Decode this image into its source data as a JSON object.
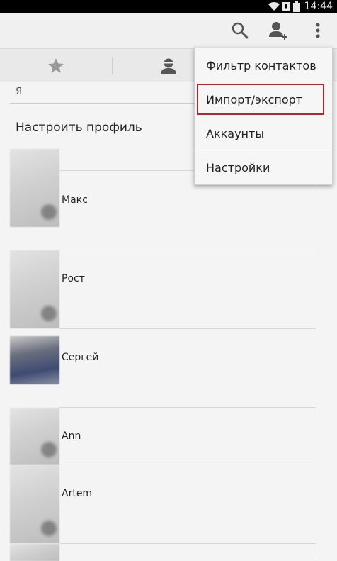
{
  "status_bar": {
    "time": "14:44",
    "icons": [
      "wifi-icon",
      "sim-icon",
      "battery-icon"
    ]
  },
  "action_bar": {
    "icons": [
      "search-icon",
      "add-contact-icon",
      "overflow-menu-icon"
    ]
  },
  "tabs": {
    "icons": [
      "star-icon",
      "person-icon"
    ]
  },
  "profile_section": {
    "header": "Я",
    "setup_label": "Настроить профиль"
  },
  "contacts": [
    {
      "name": "Макс"
    },
    {
      "name": "Рост"
    },
    {
      "name": "Сергей"
    },
    {
      "name": "Ann"
    },
    {
      "name": "Artem"
    }
  ],
  "menu": {
    "items": [
      {
        "label": "Фильтр контактов"
      },
      {
        "label": "Импорт/экспорт"
      },
      {
        "label": "Аккаунты"
      },
      {
        "label": "Настройки"
      }
    ],
    "highlighted_index": 1,
    "highlight_color": "#b8242a"
  },
  "colors": {
    "background": "#f4f4f4",
    "status_bar": "#000000",
    "icon_gray": "#555555"
  }
}
